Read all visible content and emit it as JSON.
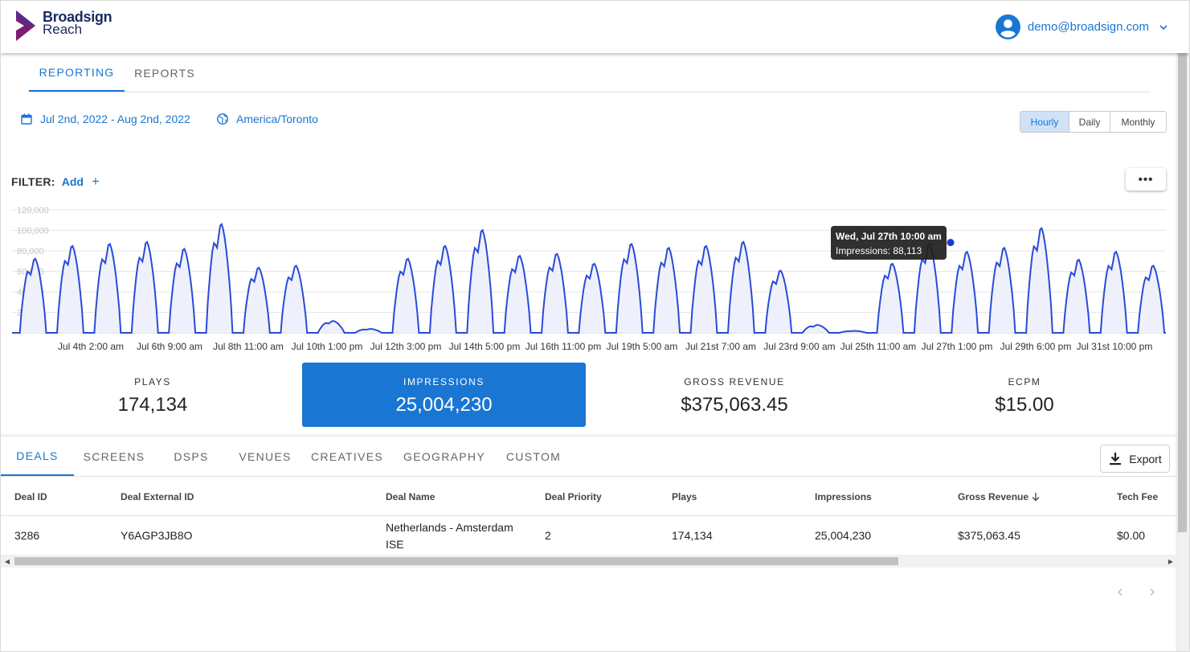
{
  "header": {
    "brand": "Broadsign",
    "product": "Reach",
    "user_email": "demo@broadsign.com",
    "brand_color": "#1a2a63",
    "accent": "#1976d2",
    "icons": {
      "logo": "chevron-logo-icon",
      "avatar": "user-circle-icon",
      "menu": "chevron-down-icon"
    }
  },
  "top_tabs": [
    {
      "label": "REPORTING",
      "active": true
    },
    {
      "label": "REPORTS",
      "active": false
    }
  ],
  "controls": {
    "date_range": "Jul 2nd, 2022 - Aug 2nd, 2022",
    "timezone": "America/Toronto",
    "granularity": [
      {
        "label": "Hourly",
        "active": true
      },
      {
        "label": "Daily",
        "active": false
      },
      {
        "label": "Monthly",
        "active": false
      }
    ],
    "filter_label": "FILTER:",
    "filter_add": "Add",
    "filter_plus": "+",
    "more_label": "•••"
  },
  "chart_data": {
    "type": "area",
    "series": [
      {
        "values": []
      }
    ],
    "ylim": [
      0,
      120000
    ],
    "y_ticks": [
      "120,000",
      "100,000",
      "80,000",
      "60,000",
      "40,000",
      "20,000"
    ],
    "x_tick_labels": [
      "Jul 4th 2:00 am",
      "Jul 6th 9:00 am",
      "Jul 8th 11:00 am",
      "Jul 10th 1:00 pm",
      "Jul 12th 3:00 pm",
      "Jul 14th 5:00 pm",
      "Jul 16th 11:00 pm",
      "Jul 19th 5:00 am",
      "Jul 21st 7:00 am",
      "Jul 23rd 9:00 am",
      "Jul 25th 11:00 am",
      "Jul 27th 1:00 pm",
      "Jul 29th 6:00 pm",
      "Jul 31st 10:00 pm"
    ],
    "daily_peaks": [
      75000,
      88000,
      90000,
      92000,
      85000,
      110000,
      66000,
      68000,
      12000,
      4000,
      75000,
      88000,
      104000,
      78000,
      80000,
      70000,
      90000,
      86000,
      88000,
      92000,
      63000,
      8000,
      2000,
      70000,
      90000,
      82000,
      86000,
      106000,
      74000,
      82000,
      68000
    ],
    "grid": true,
    "line_color": "#2a4bd7",
    "fill_color": "#eef1fb",
    "tooltip": {
      "title": "Wed, Jul 27th 10:00 am",
      "body": "Impressions: 88,113",
      "value": 88113
    }
  },
  "kpis": [
    {
      "label": "PLAYS",
      "value": "174,134",
      "active": false
    },
    {
      "label": "IMPRESSIONS",
      "value": "25,004,230",
      "active": true
    },
    {
      "label": "GROSS REVENUE",
      "value": "$375,063.45",
      "active": false
    },
    {
      "label": "ECPM",
      "value": "$15.00",
      "active": false
    }
  ],
  "bottom_tabs": [
    {
      "label": "DEALS",
      "active": true
    },
    {
      "label": "SCREENS",
      "active": false
    },
    {
      "label": "DSPS",
      "active": false
    },
    {
      "label": "VENUES",
      "active": false
    },
    {
      "label": "CREATIVES",
      "active": false
    },
    {
      "label": "GEOGRAPHY",
      "active": false
    },
    {
      "label": "CUSTOM",
      "active": false
    }
  ],
  "export_label": "Export",
  "table": {
    "columns": [
      "Deal ID",
      "Deal External ID",
      "Deal Name",
      "Deal Priority",
      "Plays",
      "Impressions",
      "Gross Revenue",
      "Tech Fee"
    ],
    "sorted_column": "Gross Revenue",
    "rows": [
      [
        "3286",
        "Y6AGP3JB8O",
        "Netherlands - Amsterdam ISE",
        "2",
        "174,134",
        "25,004,230",
        "$375,063.45",
        "$0.00"
      ]
    ]
  },
  "pager": {
    "prev": "‹",
    "next": "›"
  }
}
